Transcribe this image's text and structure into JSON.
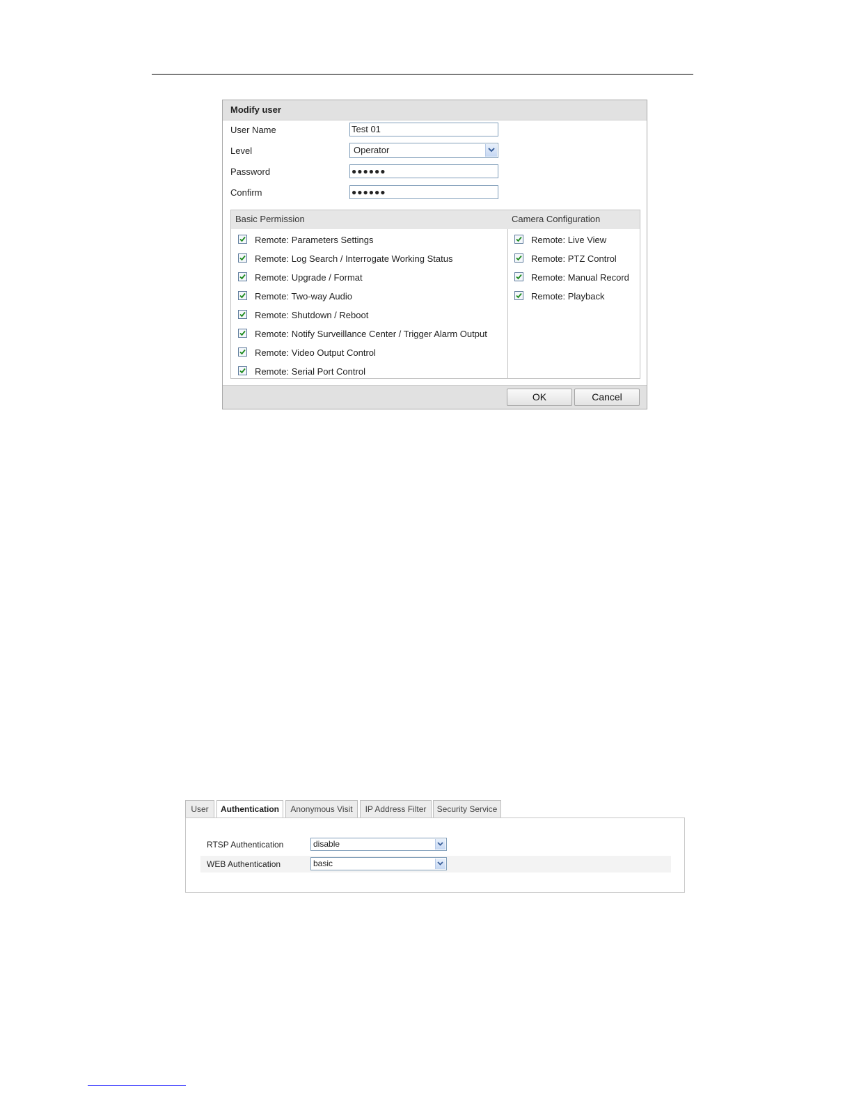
{
  "dialog": {
    "title": "Modify user",
    "fields": {
      "username_label": "User Name",
      "username_value": "Test 01",
      "level_label": "Level",
      "level_value": "Operator",
      "password_label": "Password",
      "password_value": "●●●●●●",
      "confirm_label": "Confirm",
      "confirm_value": "●●●●●●"
    },
    "basic_permission": {
      "header": "Basic Permission",
      "items": [
        {
          "label": "Remote: Parameters Settings",
          "checked": true
        },
        {
          "label": "Remote: Log Search / Interrogate Working Status",
          "checked": true
        },
        {
          "label": "Remote: Upgrade / Format",
          "checked": true
        },
        {
          "label": "Remote: Two-way Audio",
          "checked": true
        },
        {
          "label": "Remote: Shutdown / Reboot",
          "checked": true
        },
        {
          "label": "Remote: Notify Surveillance Center / Trigger Alarm Output",
          "checked": true
        },
        {
          "label": "Remote: Video Output Control",
          "checked": true
        },
        {
          "label": "Remote: Serial Port Control",
          "checked": true
        }
      ]
    },
    "camera_configuration": {
      "header": "Camera Configuration",
      "items": [
        {
          "label": "Remote: Live View",
          "checked": true
        },
        {
          "label": "Remote: PTZ Control",
          "checked": true
        },
        {
          "label": "Remote: Manual Record",
          "checked": true
        },
        {
          "label": "Remote: Playback",
          "checked": true
        }
      ]
    },
    "ok_label": "OK",
    "cancel_label": "Cancel"
  },
  "auth": {
    "tabs": [
      "User",
      "Authentication",
      "Anonymous Visit",
      "IP Address Filter",
      "Security Service"
    ],
    "active_tab": "Authentication",
    "rtsp_label": "RTSP Authentication",
    "rtsp_value": "disable",
    "web_label": "WEB Authentication",
    "web_value": "basic"
  },
  "colors": {
    "checkmark": "#1c8a1c",
    "select_arrow": "#3a5f9a"
  }
}
